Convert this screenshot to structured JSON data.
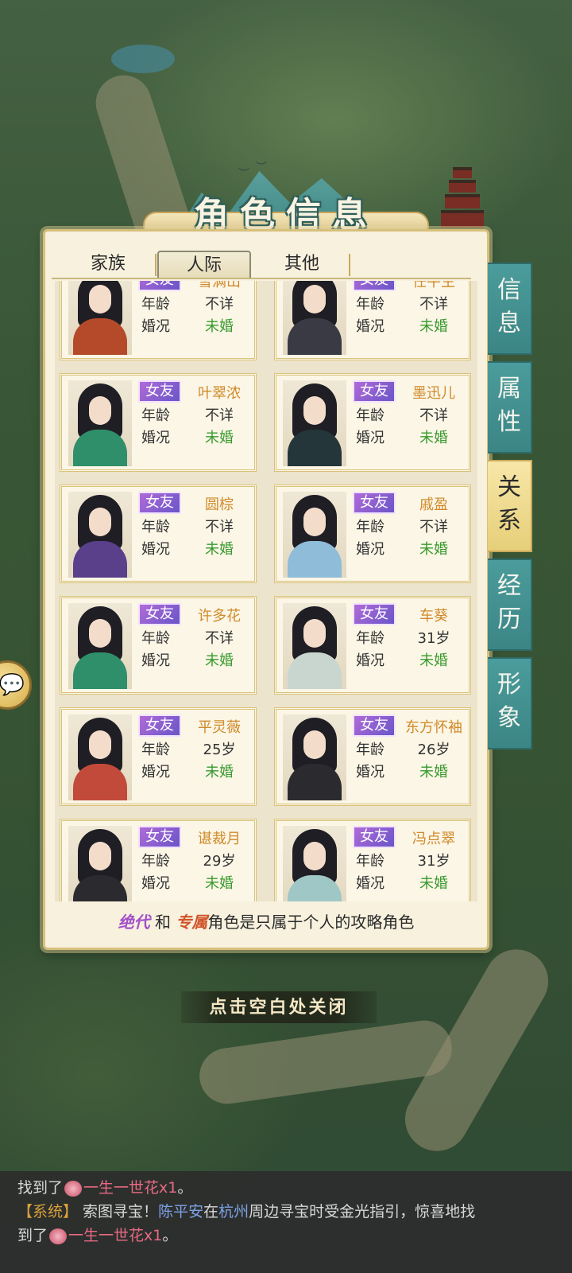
{
  "dialog": {
    "title": "角色信息",
    "tabs": [
      {
        "label": "家族"
      },
      {
        "label": "人际"
      },
      {
        "label": "其他"
      }
    ],
    "active_tab": "人际",
    "side_tabs": [
      {
        "label": "信息"
      },
      {
        "label": "属性"
      },
      {
        "label": "关系"
      },
      {
        "label": "经历"
      },
      {
        "label": "形象"
      }
    ],
    "active_side_tab": "关系",
    "field_labels": {
      "age": "年龄",
      "marital": "婚况"
    },
    "relations": [
      {
        "tag": "女友",
        "name": "雪满山",
        "age": "不详",
        "status": "未婚"
      },
      {
        "tag": "女友",
        "name": "任平生",
        "age": "不详",
        "status": "未婚"
      },
      {
        "tag": "女友",
        "name": "叶翠浓",
        "age": "不详",
        "status": "未婚"
      },
      {
        "tag": "女友",
        "name": "墨迅儿",
        "age": "不详",
        "status": "未婚"
      },
      {
        "tag": "女友",
        "name": "圆棕",
        "age": "不详",
        "status": "未婚"
      },
      {
        "tag": "女友",
        "name": "戚盈",
        "age": "不详",
        "status": "未婚"
      },
      {
        "tag": "女友",
        "name": "许多花",
        "age": "不详",
        "status": "未婚"
      },
      {
        "tag": "女友",
        "name": "车葵",
        "age": "31岁",
        "status": "未婚"
      },
      {
        "tag": "女友",
        "name": "平灵薇",
        "age": "25岁",
        "status": "未婚"
      },
      {
        "tag": "女友",
        "name": "东方怀袖",
        "age": "26岁",
        "status": "未婚"
      },
      {
        "tag": "女友",
        "name": "谌裁月",
        "age": "29岁",
        "status": "未婚"
      },
      {
        "tag": "女友",
        "name": "冯点翠",
        "age": "31岁",
        "status": "未婚"
      }
    ],
    "footnote": {
      "part1": "绝代",
      "part2": " 和 ",
      "part3": "专属",
      "part4": "角色是只属于个人的攻略角色"
    }
  },
  "close_hint": "点击空白处关闭",
  "chat": {
    "line1_prefix": "找到了",
    "line1_item": "一生一世花x1",
    "line1_suffix": "。",
    "sys_tag": "【系统】",
    "msg_a": " 索图寻宝！",
    "player": "陈平安",
    "msg_b": "在",
    "place": "杭州",
    "msg_c": "周边寻宝时受金光指引，惊喜地找",
    "line3_prefix": "到了",
    "line3_item": "一生一世花x1",
    "line3_suffix": "。"
  },
  "colors": {
    "panel_bg": "#f7f1de",
    "teal_tab": "#4b9c9c",
    "active_tab": "#f0dc8f",
    "name_orange": "#d08a2a",
    "status_green": "#3a9a2f",
    "badge_purple": "#8a5fd0"
  },
  "icons": [
    "chat-bubble-icon",
    "flower-item-icon"
  ]
}
